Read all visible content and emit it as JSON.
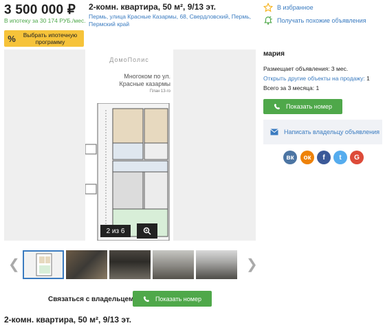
{
  "listing": {
    "price": "3 500 000 ₽",
    "mortgage_note": "В ипотеку за 30 174 РУБ./мес.",
    "mortgage_button": {
      "icon_text": "%",
      "label": "Выбрать ипотечную программу"
    },
    "title": "2-комн. квартира, 50 м², 9/13 эт.",
    "address": "Пермь, улица Красные Казармы, 68, Свердловский, Пермь, Пермский край"
  },
  "actions": {
    "favorite": {
      "label": "В избранное",
      "icon": "star-icon"
    },
    "similar": {
      "label": "Получать похожие объявления",
      "icon": "bell-icon"
    }
  },
  "gallery": {
    "watermark": "ДомоПолис",
    "plan_heading": "Многоком по ул. Красные казармы",
    "plan_subheading": "План 13-го",
    "counter": "2 из 6",
    "zoom_icon": "magnifier-plus-icon",
    "thumb_count": 5,
    "selected_thumb": 1
  },
  "seller": {
    "name": "мария",
    "posting_since": "Размещает объявления: 3 мес.",
    "other_link": "Открыть другие объекты на продажу:",
    "other_count": "1",
    "total_3months": "Всего за 3 месяца: 1",
    "show_phone": "Показать номер",
    "write_owner": "Написать владельцу объявления"
  },
  "share": {
    "networks": [
      {
        "name": "vk",
        "text": "вк",
        "color": "#4c75a3"
      },
      {
        "name": "ok",
        "text": "ок",
        "color": "#ee8208"
      },
      {
        "name": "facebook",
        "text": "f",
        "color": "#3b5998"
      },
      {
        "name": "twitter",
        "text": "t",
        "color": "#55acee"
      },
      {
        "name": "google",
        "text": "G",
        "color": "#dd4b39"
      }
    ]
  },
  "contact": {
    "label": "Связаться с владельцем",
    "show_phone": "Показать номер"
  },
  "footer": {
    "title": "2-комн. квартира, 50 м², 9/13 эт."
  },
  "colors": {
    "green": "#4fa84a",
    "link": "#3a7bc0",
    "yellow": "#f6c33a"
  }
}
